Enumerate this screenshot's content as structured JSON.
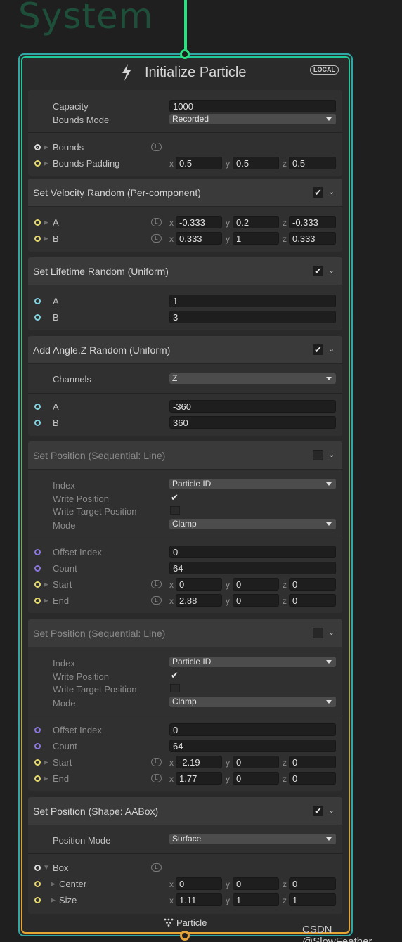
{
  "system_label": "System",
  "context": {
    "title": "Initialize Particle",
    "space_badge": "LOCAL",
    "footer_label": "Particle",
    "colors": {
      "flow_in": "#2be07f",
      "flow_out": "#e3a33a",
      "border": "#2fa7a5"
    }
  },
  "init": {
    "capacity_label": "Capacity",
    "capacity_value": "1000",
    "bounds_mode_label": "Bounds Mode",
    "bounds_mode_value": "Recorded",
    "bounds_label": "Bounds",
    "bounds_padding_label": "Bounds Padding",
    "bounds_padding": {
      "x": "0.5",
      "y": "0.5",
      "z": "0.5"
    }
  },
  "axes": {
    "x": "x",
    "y": "y",
    "z": "z"
  },
  "space_icon": "L",
  "velocity": {
    "title": "Set Velocity Random (Per-component)",
    "a_label": "A",
    "a": {
      "x": "-0.333",
      "y": "0.2",
      "z": "-0.333"
    },
    "b_label": "B",
    "b": {
      "x": "0.333",
      "y": "1",
      "z": "0.333"
    }
  },
  "lifetime": {
    "title": "Set Lifetime Random (Uniform)",
    "a_label": "A",
    "a": "1",
    "b_label": "B",
    "b": "3"
  },
  "angle": {
    "title": "Add Angle.Z Random (Uniform)",
    "channels_label": "Channels",
    "channels_value": "Z",
    "a_label": "A",
    "a": "-360",
    "b_label": "B",
    "b": "360"
  },
  "seq1": {
    "title": "Set Position (Sequential: Line)",
    "index_label": "Index",
    "index_value": "Particle ID",
    "write_position_label": "Write Position",
    "write_target_label": "Write Target Position",
    "mode_label": "Mode",
    "mode_value": "Clamp",
    "offset_label": "Offset Index",
    "offset_value": "0",
    "count_label": "Count",
    "count_value": "64",
    "start_label": "Start",
    "start": {
      "x": "0",
      "y": "0",
      "z": "0"
    },
    "end_label": "End",
    "end": {
      "x": "2.88",
      "y": "0",
      "z": "0"
    }
  },
  "seq2": {
    "title": "Set Position (Sequential: Line)",
    "index_label": "Index",
    "index_value": "Particle ID",
    "write_position_label": "Write Position",
    "write_target_label": "Write Target Position",
    "mode_label": "Mode",
    "mode_value": "Clamp",
    "offset_label": "Offset Index",
    "offset_value": "0",
    "count_label": "Count",
    "count_value": "64",
    "start_label": "Start",
    "start": {
      "x": "-2.19",
      "y": "0",
      "z": "0"
    },
    "end_label": "End",
    "end": {
      "x": "1.77",
      "y": "0",
      "z": "0"
    }
  },
  "aabox": {
    "title": "Set Position (Shape: AABox)",
    "position_mode_label": "Position Mode",
    "position_mode_value": "Surface",
    "box_label": "Box",
    "center_label": "Center",
    "center": {
      "x": "0",
      "y": "0",
      "z": "0"
    },
    "size_label": "Size",
    "size": {
      "x": "1.11",
      "y": "1",
      "z": "1"
    }
  },
  "watermark": "CSDN @SlowFeather"
}
